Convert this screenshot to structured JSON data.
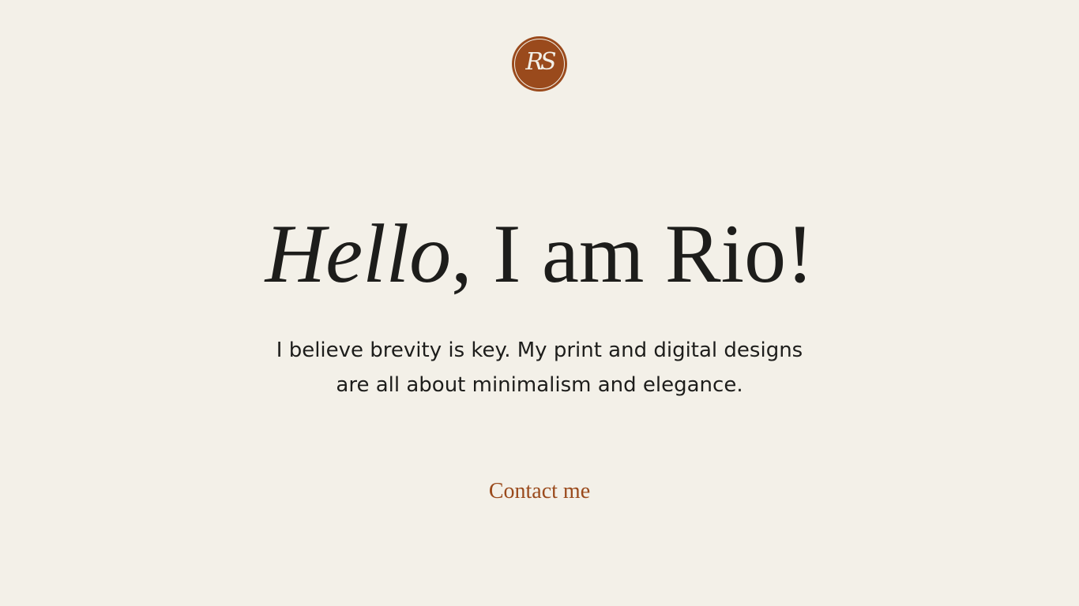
{
  "logo": {
    "monogram": "RS"
  },
  "hero": {
    "greeting": "Hello",
    "rest": ", I am Rio!",
    "intro": "I believe brevity is key. My print and digital designs are all about minimalism and elegance."
  },
  "contact": {
    "label": "Contact me"
  },
  "colors": {
    "background": "#f3f0e8",
    "accent": "#9a4a1c",
    "text": "#1d1d1b"
  }
}
